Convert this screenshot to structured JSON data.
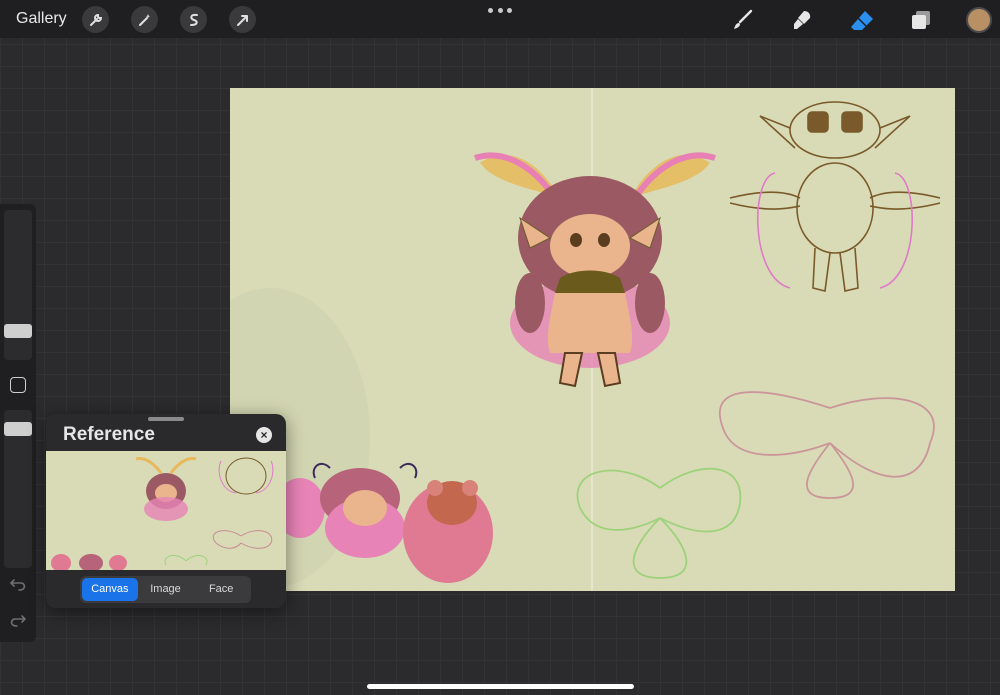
{
  "topbar": {
    "gallery_label": "Gallery",
    "left_tools": [
      "wrench-icon",
      "magic-wand-icon",
      "selection-icon",
      "transform-arrow-icon"
    ],
    "right_tools": [
      "brush-icon",
      "smudge-icon",
      "eraser-icon",
      "layers-icon"
    ],
    "active_tool": "eraser-icon",
    "current_color": "#b89063"
  },
  "reference": {
    "title": "Reference",
    "close_symbol": "×",
    "tabs": [
      "Canvas",
      "Image",
      "Face"
    ],
    "active_tab": "Canvas"
  },
  "colors": {
    "accent": "#1a73e8",
    "canvas_background": "#d8dbb6"
  }
}
